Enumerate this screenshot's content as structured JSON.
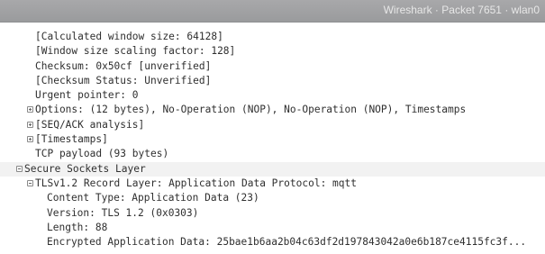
{
  "titlebar": {
    "title": "Wireshark · Packet 7651 · wlan0"
  },
  "tree": {
    "rows": [
      {
        "text": "[Calculated window size: 64128]"
      },
      {
        "text": "[Window size scaling factor: 128]"
      },
      {
        "text": "Checksum: 0x50cf [unverified]"
      },
      {
        "text": "[Checksum Status: Unverified]"
      },
      {
        "text": "Urgent pointer: 0"
      },
      {
        "text": "Options: (12 bytes), No-Operation (NOP), No-Operation (NOP), Timestamps"
      },
      {
        "text": "[SEQ/ACK analysis]"
      },
      {
        "text": "[Timestamps]"
      },
      {
        "text": "TCP payload (93 bytes)"
      },
      {
        "text": "Secure Sockets Layer"
      },
      {
        "text": "TLSv1.2 Record Layer: Application Data Protocol: mqtt"
      },
      {
        "text": "Content Type: Application Data (23)"
      },
      {
        "text": "Version: TLS 1.2 (0x0303)"
      },
      {
        "text": "Length: 88"
      },
      {
        "text": "Encrypted Application Data: 25bae1b6aa2b04c63df2d197843042a0e6b187ce4115fc3f..."
      }
    ]
  }
}
